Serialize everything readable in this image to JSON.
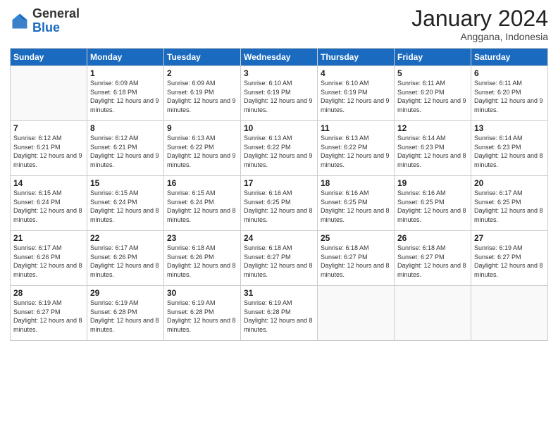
{
  "header": {
    "logo": {
      "general": "General",
      "blue": "Blue"
    },
    "title": "January 2024",
    "subtitle": "Anggana, Indonesia"
  },
  "calendar": {
    "weekdays": [
      "Sunday",
      "Monday",
      "Tuesday",
      "Wednesday",
      "Thursday",
      "Friday",
      "Saturday"
    ],
    "weeks": [
      [
        {
          "day": "",
          "info": ""
        },
        {
          "day": "1",
          "sunrise": "6:09 AM",
          "sunset": "6:18 PM",
          "daylight": "12 hours and 9 minutes."
        },
        {
          "day": "2",
          "sunrise": "6:09 AM",
          "sunset": "6:19 PM",
          "daylight": "12 hours and 9 minutes."
        },
        {
          "day": "3",
          "sunrise": "6:10 AM",
          "sunset": "6:19 PM",
          "daylight": "12 hours and 9 minutes."
        },
        {
          "day": "4",
          "sunrise": "6:10 AM",
          "sunset": "6:19 PM",
          "daylight": "12 hours and 9 minutes."
        },
        {
          "day": "5",
          "sunrise": "6:11 AM",
          "sunset": "6:20 PM",
          "daylight": "12 hours and 9 minutes."
        },
        {
          "day": "6",
          "sunrise": "6:11 AM",
          "sunset": "6:20 PM",
          "daylight": "12 hours and 9 minutes."
        }
      ],
      [
        {
          "day": "7",
          "sunrise": "6:12 AM",
          "sunset": "6:21 PM",
          "daylight": "12 hours and 9 minutes."
        },
        {
          "day": "8",
          "sunrise": "6:12 AM",
          "sunset": "6:21 PM",
          "daylight": "12 hours and 9 minutes."
        },
        {
          "day": "9",
          "sunrise": "6:13 AM",
          "sunset": "6:22 PM",
          "daylight": "12 hours and 9 minutes."
        },
        {
          "day": "10",
          "sunrise": "6:13 AM",
          "sunset": "6:22 PM",
          "daylight": "12 hours and 9 minutes."
        },
        {
          "day": "11",
          "sunrise": "6:13 AM",
          "sunset": "6:22 PM",
          "daylight": "12 hours and 9 minutes."
        },
        {
          "day": "12",
          "sunrise": "6:14 AM",
          "sunset": "6:23 PM",
          "daylight": "12 hours and 8 minutes."
        },
        {
          "day": "13",
          "sunrise": "6:14 AM",
          "sunset": "6:23 PM",
          "daylight": "12 hours and 8 minutes."
        }
      ],
      [
        {
          "day": "14",
          "sunrise": "6:15 AM",
          "sunset": "6:24 PM",
          "daylight": "12 hours and 8 minutes."
        },
        {
          "day": "15",
          "sunrise": "6:15 AM",
          "sunset": "6:24 PM",
          "daylight": "12 hours and 8 minutes."
        },
        {
          "day": "16",
          "sunrise": "6:15 AM",
          "sunset": "6:24 PM",
          "daylight": "12 hours and 8 minutes."
        },
        {
          "day": "17",
          "sunrise": "6:16 AM",
          "sunset": "6:25 PM",
          "daylight": "12 hours and 8 minutes."
        },
        {
          "day": "18",
          "sunrise": "6:16 AM",
          "sunset": "6:25 PM",
          "daylight": "12 hours and 8 minutes."
        },
        {
          "day": "19",
          "sunrise": "6:16 AM",
          "sunset": "6:25 PM",
          "daylight": "12 hours and 8 minutes."
        },
        {
          "day": "20",
          "sunrise": "6:17 AM",
          "sunset": "6:25 PM",
          "daylight": "12 hours and 8 minutes."
        }
      ],
      [
        {
          "day": "21",
          "sunrise": "6:17 AM",
          "sunset": "6:26 PM",
          "daylight": "12 hours and 8 minutes."
        },
        {
          "day": "22",
          "sunrise": "6:17 AM",
          "sunset": "6:26 PM",
          "daylight": "12 hours and 8 minutes."
        },
        {
          "day": "23",
          "sunrise": "6:18 AM",
          "sunset": "6:26 PM",
          "daylight": "12 hours and 8 minutes."
        },
        {
          "day": "24",
          "sunrise": "6:18 AM",
          "sunset": "6:27 PM",
          "daylight": "12 hours and 8 minutes."
        },
        {
          "day": "25",
          "sunrise": "6:18 AM",
          "sunset": "6:27 PM",
          "daylight": "12 hours and 8 minutes."
        },
        {
          "day": "26",
          "sunrise": "6:18 AM",
          "sunset": "6:27 PM",
          "daylight": "12 hours and 8 minutes."
        },
        {
          "day": "27",
          "sunrise": "6:19 AM",
          "sunset": "6:27 PM",
          "daylight": "12 hours and 8 minutes."
        }
      ],
      [
        {
          "day": "28",
          "sunrise": "6:19 AM",
          "sunset": "6:27 PM",
          "daylight": "12 hours and 8 minutes."
        },
        {
          "day": "29",
          "sunrise": "6:19 AM",
          "sunset": "6:28 PM",
          "daylight": "12 hours and 8 minutes."
        },
        {
          "day": "30",
          "sunrise": "6:19 AM",
          "sunset": "6:28 PM",
          "daylight": "12 hours and 8 minutes."
        },
        {
          "day": "31",
          "sunrise": "6:19 AM",
          "sunset": "6:28 PM",
          "daylight": "12 hours and 8 minutes."
        },
        {
          "day": "",
          "info": ""
        },
        {
          "day": "",
          "info": ""
        },
        {
          "day": "",
          "info": ""
        }
      ]
    ]
  }
}
